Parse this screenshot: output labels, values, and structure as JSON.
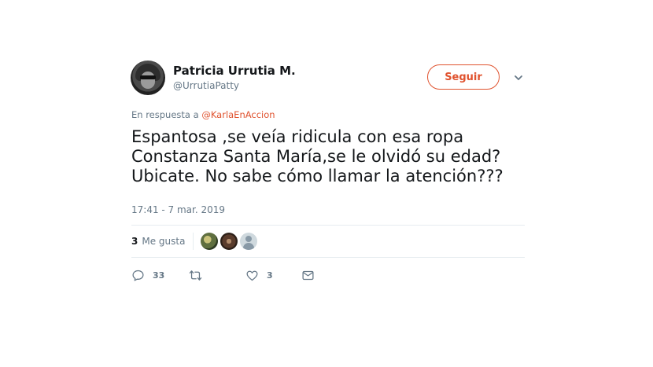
{
  "author": {
    "name": "Patricia Urrutia M.",
    "handle": "@UrrutiaPatty"
  },
  "follow_button": {
    "label": "Seguir"
  },
  "reply": {
    "prefix": "En respuesta a",
    "mention": "@KarlaEnAccion"
  },
  "tweet": {
    "lines": [
      "Espantosa ,se veía ridicula con esa ropa",
      "Constanza Santa María,se le olvidó su edad?",
      "Ubicate. No sabe cómo llamar la atención???"
    ],
    "timestamp": "17:41 - 7 mar. 2019"
  },
  "likes": {
    "count": "3",
    "label": "Me gusta"
  },
  "actions": {
    "reply_count": "33",
    "retweet_count": "",
    "like_count": "3"
  },
  "colors": {
    "accent": "#e0532f",
    "text": "#14171a",
    "secondary": "#657786",
    "divider": "#e6ecf0"
  },
  "icons": [
    "chevron-down-icon",
    "reply-icon",
    "retweet-icon",
    "heart-icon",
    "message-icon"
  ]
}
